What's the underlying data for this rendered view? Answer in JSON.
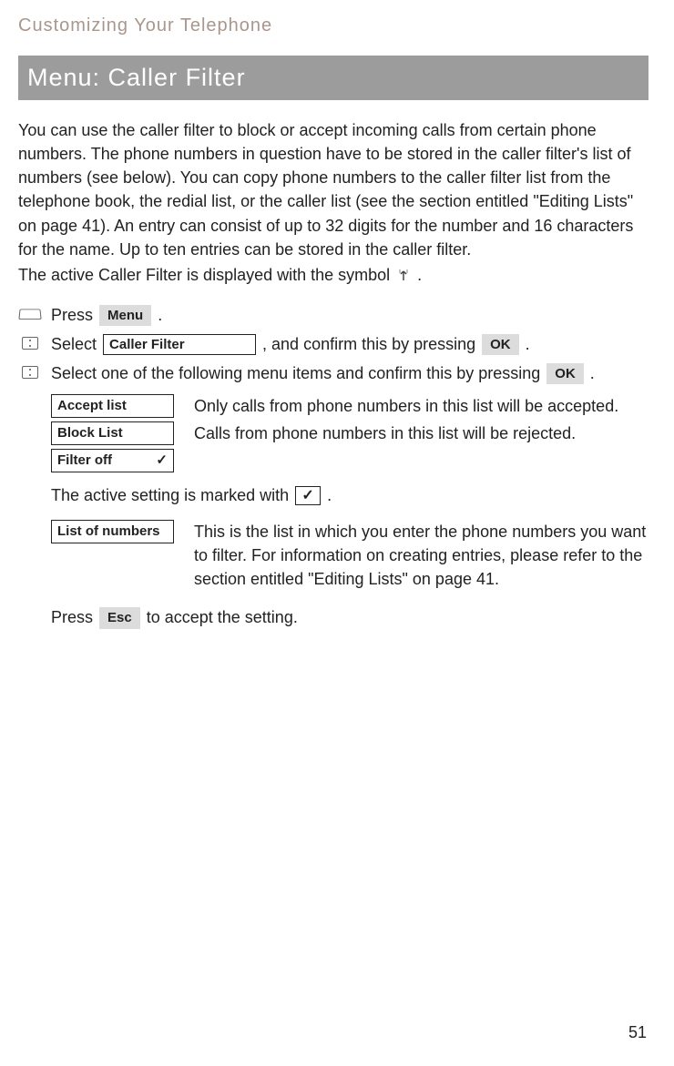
{
  "chapter_title": "Customizing Your Telephone",
  "section_title": "Menu: Caller Filter",
  "intro": {
    "p1": "You can use the caller filter to block or accept incoming calls from certain phone numbers. The phone numbers in question have to be stored in the caller filter's list of numbers (see below). You can copy phone numbers to the caller filter list from the telephone book, the redial list, or the caller list (see the section entitled \"Editing Lists\" on page 41). An entry can consist of up to 32 digits for the number and 16 characters for the name. Up to ten entries can be stored in the caller filter.",
    "p2_prefix": "The active Caller Filter is displayed with the symbol ",
    "p2_suffix": " ."
  },
  "buttons": {
    "menu": "Menu",
    "ok": "OK",
    "esc": "Esc",
    "caller_filter": "Caller Filter",
    "accept_list": "Accept list",
    "block_list": "Block List",
    "filter_off": "Filter off",
    "list_of_numbers": "List of numbers",
    "check": "✓"
  },
  "steps": {
    "s1_a": "Press ",
    "s1_b": " .",
    "s2_a": "Select ",
    "s2_b": " , and confirm this by pressing ",
    "s2_c": " .",
    "s3_a": "Select one of the following menu items and confirm this by pressing ",
    "s3_b": " ."
  },
  "menu_items": {
    "accept_desc": "Only calls from phone numbers in this list will be accepted.",
    "block_desc": "Calls from phone numbers in this list will be rejected."
  },
  "after_menu_a": "The active setting is marked with ",
  "after_menu_b": " .",
  "list_of_numbers_desc": "This is the list in which you enter the phone numbers you want to filter. For information on creating entries, please refer to the section entitled \"Editing Lists\" on page 41.",
  "press_esc_a": "Press ",
  "press_esc_b": " to accept the setting.",
  "page_number": "51"
}
